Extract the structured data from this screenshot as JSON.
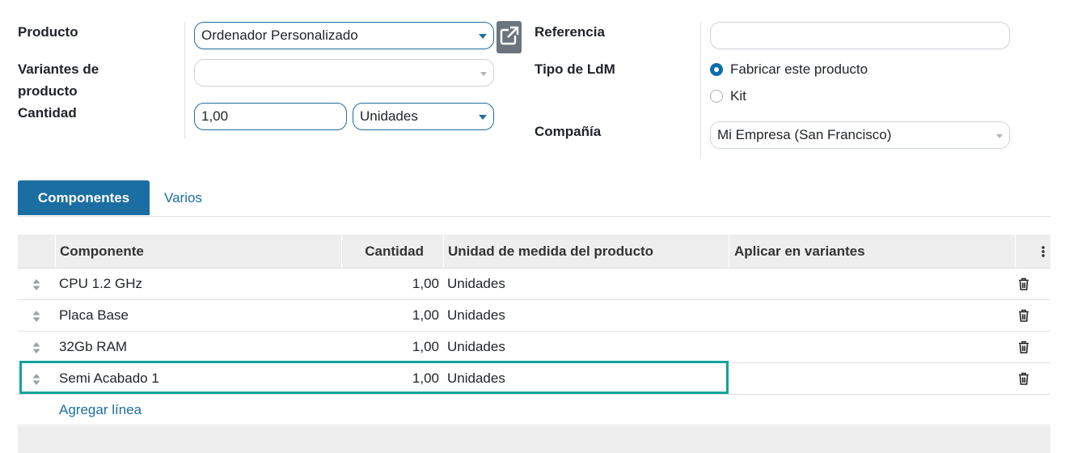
{
  "form": {
    "product_label": "Producto",
    "product_value": "Ordenador Personalizado",
    "variants_label_1": "Variantes de",
    "variants_label_2": "producto",
    "variants_value": "",
    "quantity_label": "Cantidad",
    "quantity_value": "1,00",
    "uom_value": "Unidades",
    "reference_label": "Referencia",
    "reference_value": "",
    "bom_type_label": "Tipo de LdM",
    "bom_type_options": [
      {
        "label": "Fabricar este producto",
        "selected": true
      },
      {
        "label": "Kit",
        "selected": false
      }
    ],
    "company_label": "Compañía",
    "company_value": "Mi Empresa (San Francisco)"
  },
  "tabs": [
    {
      "label": "Componentes",
      "active": true
    },
    {
      "label": "Varios",
      "active": false
    }
  ],
  "table": {
    "columns": [
      "Componente",
      "Cantidad",
      "Unidad de medida del producto",
      "Aplicar en variantes"
    ],
    "rows": [
      {
        "component": "CPU 1.2 GHz",
        "quantity": "1,00",
        "uom": "Unidades",
        "variants": ""
      },
      {
        "component": "Placa Base",
        "quantity": "1,00",
        "uom": "Unidades",
        "variants": ""
      },
      {
        "component": "32Gb RAM",
        "quantity": "1,00",
        "uom": "Unidades",
        "variants": ""
      },
      {
        "component": "Semi Acabado 1",
        "quantity": "1,00",
        "uom": "Unidades",
        "variants": ""
      }
    ],
    "add_line": "Agregar línea"
  },
  "colors": {
    "accent": "#1b6ea1",
    "highlight": "#13a39a",
    "header_bg": "#eeeeee"
  },
  "icons": {
    "external_link": "external-link-icon",
    "row_handle": "drag-handle-icon",
    "delete": "trash-icon",
    "column_options": "kebab-menu-icon"
  }
}
